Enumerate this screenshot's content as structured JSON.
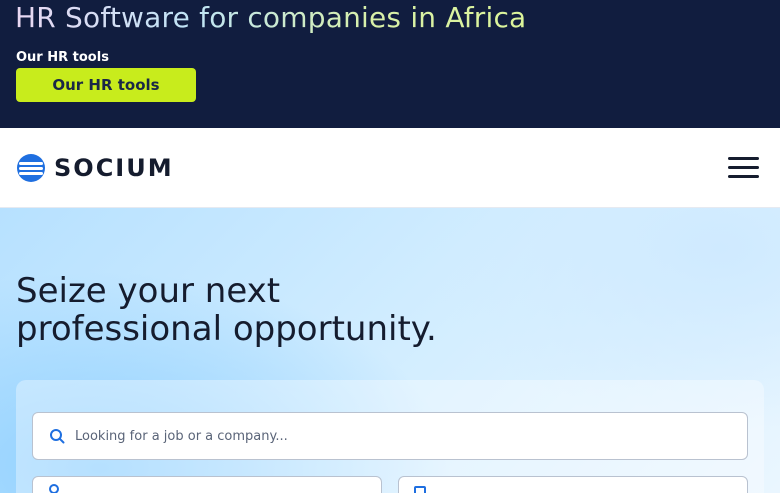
{
  "promo": {
    "title": "HR Software for companies in Africa",
    "small_label": "Our HR tools",
    "button_label": "Our HR tools"
  },
  "header": {
    "logo_text": "SOCIUM"
  },
  "hero": {
    "title_line1": "Seize your next",
    "title_line2": "professional opportunity."
  },
  "search": {
    "placeholder": "Looking for a job or a company..."
  },
  "colors": {
    "banner_bg": "#111d3f",
    "accent_lime": "#c8ec1c",
    "brand_blue": "#1f6fe0",
    "text_dark": "#151c2e"
  }
}
